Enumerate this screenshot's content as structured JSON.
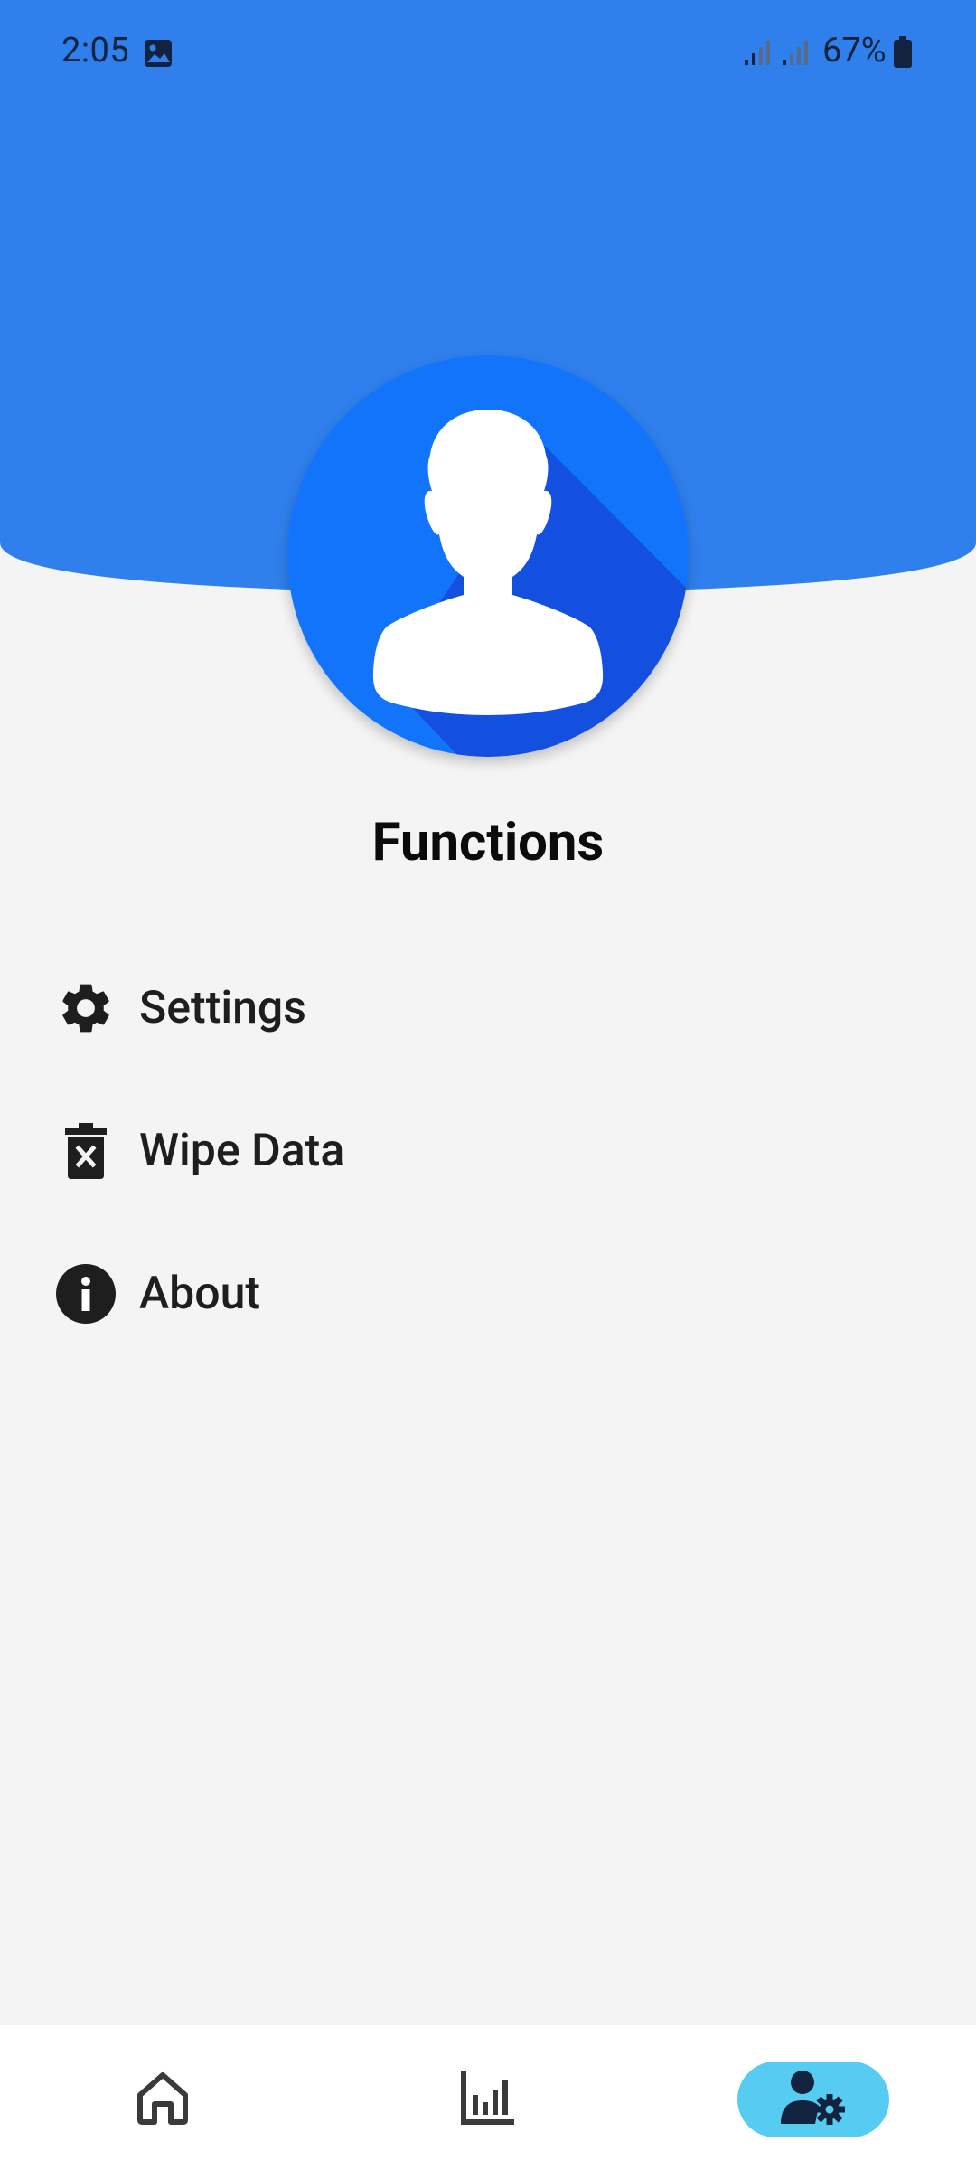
{
  "status_bar": {
    "time": "2:05",
    "battery_percent": "67%"
  },
  "colors": {
    "header_blue": "#2f80ed",
    "avatar_blue": "#1273fb",
    "avatar_shadow_blue": "#1450e0",
    "active_nav": "#56ccf2",
    "background": "#f4f4f4"
  },
  "page": {
    "title": "Functions"
  },
  "menu": {
    "items": [
      {
        "label": "Settings",
        "icon": "gear-icon"
      },
      {
        "label": "Wipe Data",
        "icon": "trash-x-icon"
      },
      {
        "label": "About",
        "icon": "info-icon"
      }
    ]
  },
  "bottom_nav": {
    "items": [
      {
        "icon": "home-icon",
        "active": false
      },
      {
        "icon": "bar-chart-icon",
        "active": false
      },
      {
        "icon": "user-gear-icon",
        "active": true
      }
    ]
  }
}
